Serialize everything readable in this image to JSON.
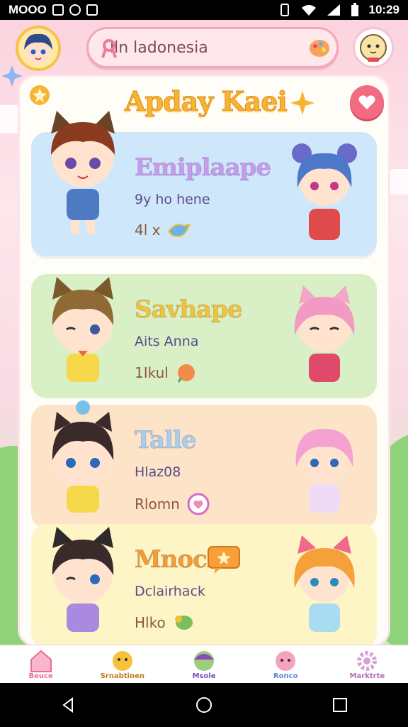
{
  "status": {
    "left_text": "MOOO",
    "time": "10:29"
  },
  "search": {
    "value": "lln ladonesia"
  },
  "header": {
    "title": "Apday Kaei"
  },
  "cards": [
    {
      "name": "Emiplaape",
      "sub": "9y ho hene",
      "meta": "4l x",
      "bg": "#cfe7fb",
      "name_color": "#c79bf0"
    },
    {
      "name": "Savhape",
      "sub": "Aits Anna",
      "meta": "1Ikul",
      "bg": "#d9efc6",
      "name_color": "#f3c23a"
    },
    {
      "name": "Talle",
      "sub": "Hlaz08",
      "meta": "Rlomn",
      "bg": "#fde3c8",
      "name_color": "#a9cdf2"
    },
    {
      "name": "Mnocik",
      "sub": "Dclairhack",
      "meta": "Hlko",
      "bg": "#fdf5c6",
      "name_color": "#f39a3a"
    }
  ],
  "nav": {
    "items": [
      {
        "label": "Beuce",
        "color": "#f06a8c"
      },
      {
        "label": "Srnabtinen",
        "color": "#c07a17"
      },
      {
        "label": "Msole",
        "color": "#7a4ac0"
      },
      {
        "label": "Ronco",
        "color": "#5a8ad8"
      },
      {
        "label": "Marktrte",
        "color": "#b66ab0"
      }
    ]
  }
}
